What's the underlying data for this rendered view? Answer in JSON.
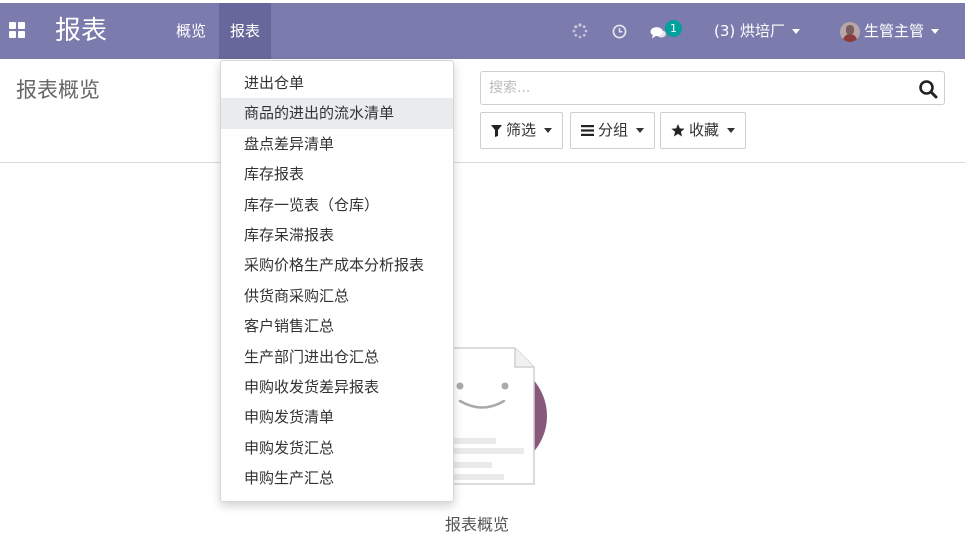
{
  "navbar": {
    "app_title": "报表",
    "menus": [
      {
        "label": "概览"
      },
      {
        "label": "报表"
      }
    ],
    "chat_badge": "1",
    "company": "(3) 烘培厂",
    "user": "生管主管",
    "colors": {
      "bar": "#7c7bad",
      "active": "#67679b",
      "badge": "#00a09d"
    }
  },
  "control_panel": {
    "title": "报表概览",
    "search_placeholder": "搜索...",
    "filters_label": "筛选",
    "groupby_label": "分组",
    "favorites_label": "收藏"
  },
  "dropdown": {
    "items": [
      {
        "label": "进出仓单"
      },
      {
        "label": "商品的进出的流水清单"
      },
      {
        "label": "盘点差异清单"
      },
      {
        "label": "库存报表"
      },
      {
        "label": "库存一览表（仓库）"
      },
      {
        "label": "库存呆滞报表"
      },
      {
        "label": "采购价格生产成本分析报表"
      },
      {
        "label": "供货商采购汇总"
      },
      {
        "label": "客户销售汇总"
      },
      {
        "label": "生产部门进出仓汇总"
      },
      {
        "label": "申购收发货差异报表"
      },
      {
        "label": "申购发货清单"
      },
      {
        "label": "申购发货汇总"
      },
      {
        "label": "申购生产汇总"
      }
    ]
  },
  "content": {
    "empty_label": "报表概览"
  }
}
